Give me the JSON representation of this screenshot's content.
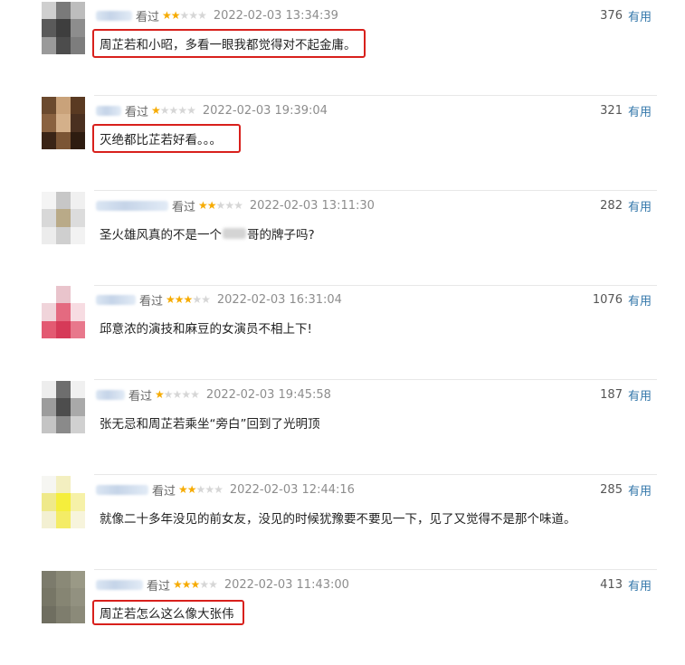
{
  "ui": {
    "watched_label": "看过",
    "useful_label": "有用",
    "colors": {
      "star_on": "#f6ab00",
      "star_off": "#d6d6d6",
      "useful_link": "#3377aa",
      "highlight_border": "#d8201c",
      "time_text": "#8d8d8d"
    }
  },
  "reviews": [
    {
      "rating": 2,
      "time": "2022-02-03 13:34:39",
      "votes": "376",
      "comment": "周芷若和小昭，多看一眼我都觉得对不起金庸。",
      "highlighted": true
    },
    {
      "rating": 1,
      "time": "2022-02-03 19:39:04",
      "votes": "321",
      "comment": "灭绝都比芷若好看。。。",
      "highlighted": true
    },
    {
      "rating": 2,
      "time": "2022-02-03 13:11:30",
      "votes": "282",
      "comment_before": "圣火雄风真的不是一个",
      "comment_after": "哥的牌子吗?",
      "highlighted": false
    },
    {
      "rating": 3,
      "time": "2022-02-03 16:31:04",
      "votes": "1076",
      "comment": "邱意浓的演技和麻豆的女演员不相上下!",
      "highlighted": false
    },
    {
      "rating": 1,
      "time": "2022-02-03 19:45:58",
      "votes": "187",
      "comment": "张无忌和周芷若乘坐“旁白”回到了光明顶",
      "highlighted": false
    },
    {
      "rating": 2,
      "time": "2022-02-03 12:44:16",
      "votes": "285",
      "comment": "就像二十多年没见的前女友，没见的时候犹豫要不要见一下，见了又觉得不是那个味道。",
      "highlighted": false
    },
    {
      "rating": 3,
      "time": "2022-02-03 11:43:00",
      "votes": "413",
      "comment": "周芷若怎么这么像大张伟",
      "highlighted": true
    }
  ]
}
